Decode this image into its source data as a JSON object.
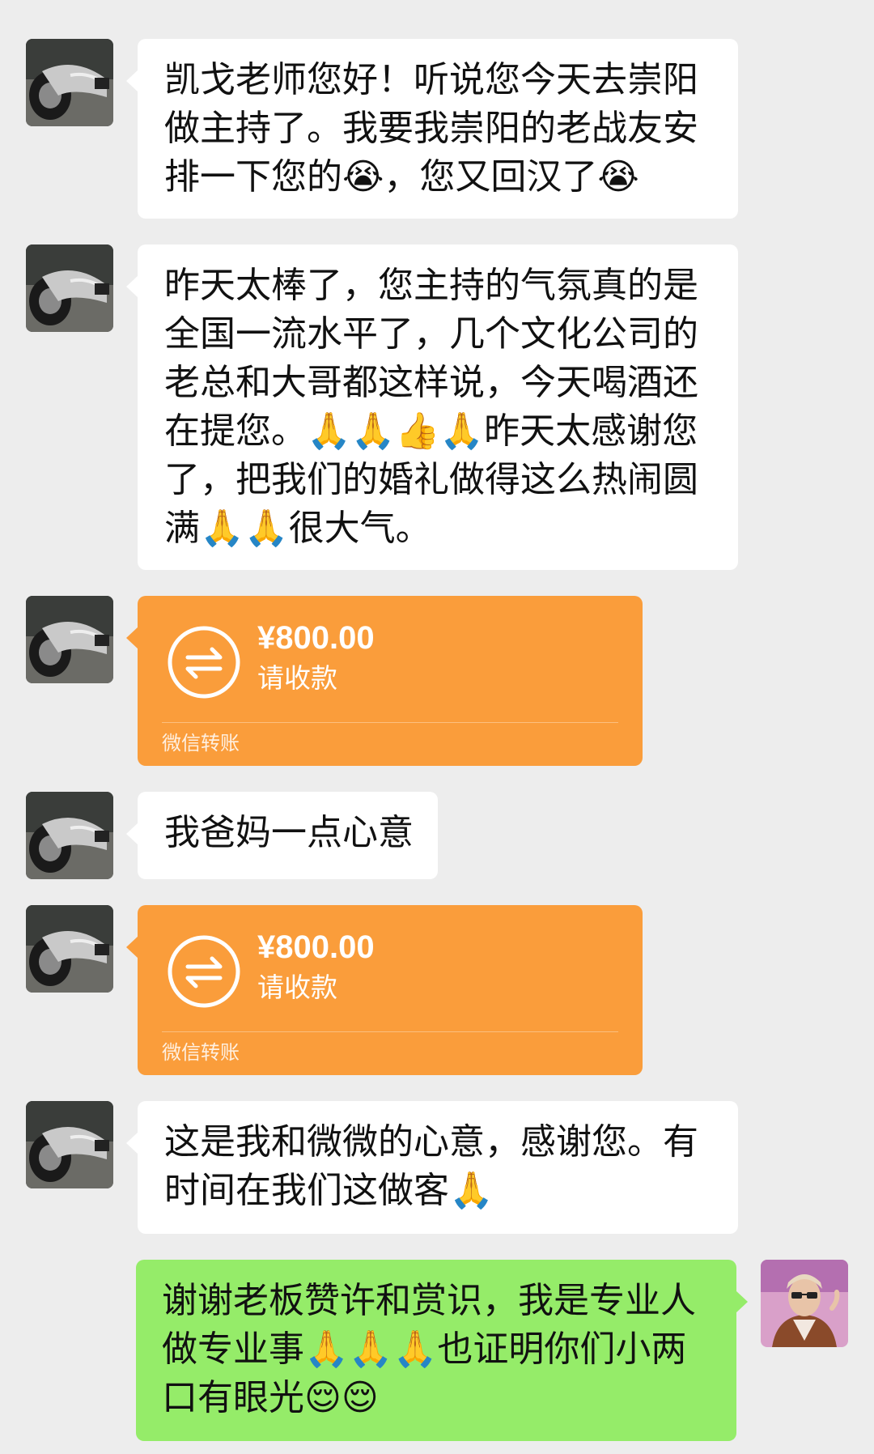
{
  "messages": [
    {
      "side": "left",
      "type": "text",
      "text": "凯戈老师您好！听说您今天去崇阳做主持了。我要我崇阳的老战友安排一下您的😭，您又回汉了😭"
    },
    {
      "side": "left",
      "type": "text",
      "text": "昨天太棒了，您主持的气氛真的是全国一流水平了，几个文化公司的老总和大哥都这样说，今天喝酒还在提您。🙏🙏👍🙏昨天太感谢您了，把我们的婚礼做得这么热闹圆满🙏🙏很大气。"
    },
    {
      "side": "left",
      "type": "transfer",
      "amount": "¥800.00",
      "status": "请收款",
      "footer": "微信转账"
    },
    {
      "side": "left",
      "type": "text",
      "text": "我爸妈一点心意"
    },
    {
      "side": "left",
      "type": "transfer",
      "amount": "¥800.00",
      "status": "请收款",
      "footer": "微信转账"
    },
    {
      "side": "left",
      "type": "text",
      "text": "这是我和微微的心意，感谢您。有时间在我们这做客🙏"
    },
    {
      "side": "right",
      "type": "text",
      "text": "谢谢老板赞许和赏识，我是专业人做专业事🙏🙏🙏也证明你们小两口有眼光😌😌"
    }
  ],
  "colors": {
    "background": "#EDEDED",
    "bubble_received": "#FFFFFF",
    "bubble_sent": "#95EC69",
    "transfer_card": "#FA9D3B"
  },
  "icons": {
    "transfer": "transfer-arrows-icon",
    "avatar_contact": "motorcycle-photo",
    "avatar_self": "man-portrait-photo"
  }
}
